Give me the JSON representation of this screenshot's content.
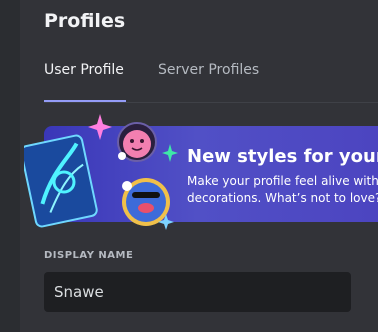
{
  "header": {
    "title": "Profiles"
  },
  "tabs": [
    {
      "label": "User Profile",
      "active": true
    },
    {
      "label": "Server Profiles",
      "active": false
    }
  ],
  "promo": {
    "title": "New styles for your pr",
    "description": "Make your profile feel alive with decorations. What’s not to love?",
    "icons": [
      "holo-card-icon",
      "pink-creature-icon",
      "blue-creature-icon",
      "sparkle-icon"
    ]
  },
  "display_name": {
    "label": "DISPLAY NAME",
    "value": "Snawe"
  },
  "colors": {
    "background": "#323338",
    "accent": "#949cf7",
    "banner": "#4c4bc2",
    "input_bg": "#1e1f22"
  }
}
